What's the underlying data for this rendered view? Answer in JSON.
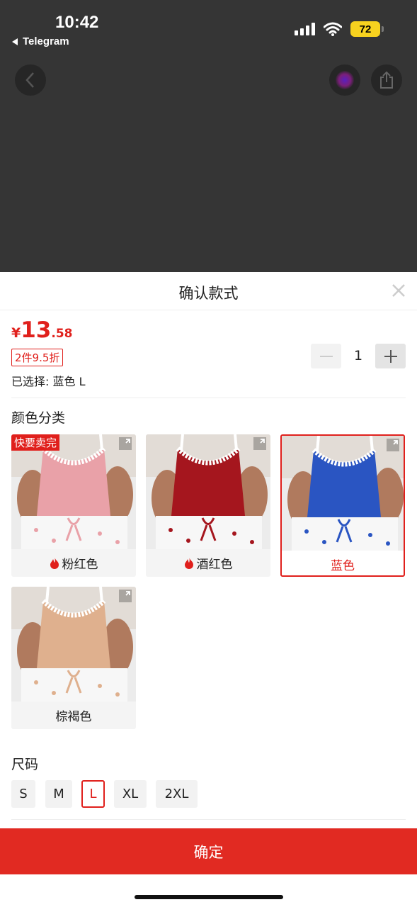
{
  "status_bar": {
    "time": "10:42",
    "back_app": "Telegram",
    "battery": "72"
  },
  "sheet": {
    "title": "确认款式",
    "price": {
      "symbol": "¥",
      "integer": "13",
      "decimal": ".58"
    },
    "promo": "2件9.5折",
    "selected": "已选择: 蓝色 L",
    "quantity": "1",
    "color_label": "颜色分类",
    "colors": [
      {
        "name": "粉红色",
        "hot": true,
        "badge": "快要卖完",
        "selected": false,
        "top_color": "#e9a1a8"
      },
      {
        "name": "酒红色",
        "hot": true,
        "badge": "",
        "selected": false,
        "top_color": "#a5161e"
      },
      {
        "name": "蓝色",
        "hot": false,
        "badge": "",
        "selected": true,
        "top_color": "#2a55c2"
      },
      {
        "name": "棕褐色",
        "hot": false,
        "badge": "",
        "selected": false,
        "top_color": "#dfb08e"
      }
    ],
    "size_label": "尺码",
    "sizes": [
      {
        "label": "S",
        "active": false
      },
      {
        "label": "M",
        "active": false
      },
      {
        "label": "L",
        "active": true
      },
      {
        "label": "XL",
        "active": false
      },
      {
        "label": "2XL",
        "active": false
      }
    ],
    "confirm_label": "确定"
  },
  "colors": {
    "accent": "#e0201c",
    "topbar": "#353535"
  }
}
